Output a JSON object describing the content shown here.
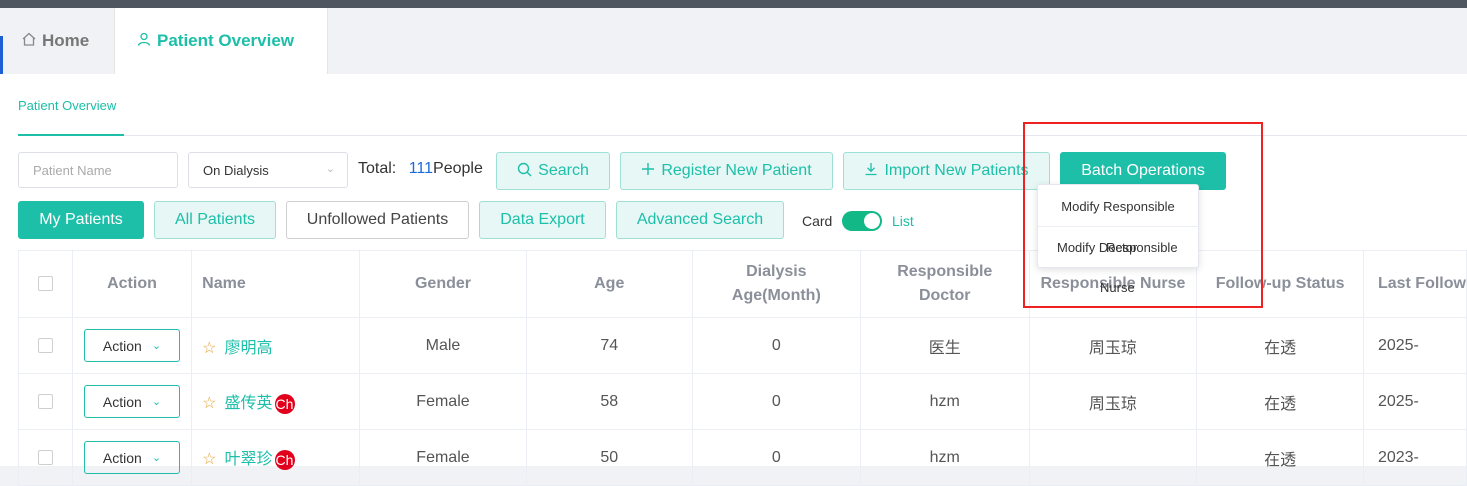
{
  "tabs": {
    "home_label": "Home",
    "home_icon": "house-icon",
    "overview_label": "Patient Overview",
    "overview_icon": "user-icon"
  },
  "subtab": {
    "label": "Patient Overview"
  },
  "filters": {
    "name_placeholder": "Patient Name",
    "status_value": "On Dialysis",
    "total_prefix": "Total:",
    "total_count": "111",
    "total_suffix": "People"
  },
  "toolbar": {
    "search_label": "Search",
    "register_label": "Register New Patient",
    "import_label": "Import New Patients",
    "batch_label": "Batch Operations",
    "my_patients_label": "My Patients",
    "all_patients_label": "All Patients",
    "unfollowed_label": "Unfollowed Patients",
    "data_export_label": "Data Export",
    "advanced_search_label": "Advanced Search",
    "card_label": "Card",
    "list_label": "List"
  },
  "dropdown": {
    "item1": "Modify Responsible",
    "item2_line1": "Modify Doctor",
    "item2_line2": "Responsible",
    "item2_line3": "Nurse"
  },
  "table": {
    "headers": {
      "action": "Action",
      "name": "Name",
      "gender": "Gender",
      "age": "Age",
      "dialysis_age": "Dialysis Age(Month)",
      "doctor": "Responsible Doctor",
      "nurse": "Responsible Nurse",
      "follow_status": "Follow-up Status",
      "last_follow": "Last Follow"
    },
    "rows": [
      {
        "action": "Action",
        "name": "廖明高",
        "badge": "",
        "gender": "Male",
        "age": "74",
        "dialysis_age": "0",
        "doctor": "医生",
        "nurse": "周玉琼",
        "status": "在透",
        "last": "2025-"
      },
      {
        "action": "Action",
        "name": "盛传英",
        "badge": "Ch",
        "gender": "Female",
        "age": "58",
        "dialysis_age": "0",
        "doctor": "hzm",
        "nurse": "周玉琼",
        "status": "在透",
        "last": "2025-"
      },
      {
        "action": "Action",
        "name": "叶翠珍",
        "badge": "Ch",
        "gender": "Female",
        "age": "50",
        "dialysis_age": "0",
        "doctor": "hzm",
        "nurse": "",
        "status": "在透",
        "last": "2023-"
      }
    ]
  },
  "colors": {
    "accent": "#1dbfa9",
    "count": "#1a6cd8",
    "badge": "#e0001b",
    "highlight": "#ee2222"
  }
}
